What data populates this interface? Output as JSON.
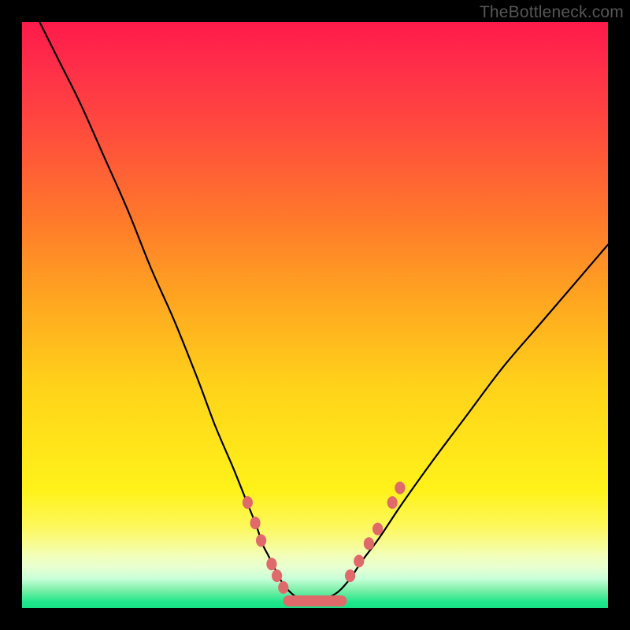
{
  "watermark": "TheBottleneck.com",
  "colors": {
    "marker": "#e06a6a",
    "curve": "#000000",
    "background_black": "#000000",
    "gradient_top": "#ff1a4a",
    "gradient_bottom": "#18e085"
  },
  "chart_data": {
    "type": "line",
    "title": "",
    "xlabel": "",
    "ylabel": "",
    "xlim": [
      0,
      100
    ],
    "ylim": [
      0,
      100
    ],
    "grid": false,
    "legend": false,
    "series": [
      {
        "name": "bottleneck-curve",
        "x": [
          3,
          6,
          10,
          14,
          18,
          22,
          26,
          30,
          33,
          36,
          38,
          40,
          41,
          42,
          43,
          44,
          45,
          46,
          47,
          48,
          49,
          50,
          51,
          52,
          54,
          56,
          58,
          61,
          65,
          70,
          76,
          82,
          88,
          94,
          100
        ],
        "y": [
          100,
          94,
          86,
          77,
          68,
          58,
          49,
          39,
          31,
          24,
          19,
          14,
          11,
          9,
          7,
          5,
          3.5,
          2.5,
          1.7,
          1.2,
          1,
          1,
          1.2,
          1.6,
          2.8,
          5,
          8,
          12,
          18,
          25,
          33,
          41,
          48,
          55,
          62
        ]
      }
    ],
    "markers": {
      "name": "highlight-points",
      "points": [
        {
          "x": 38.5,
          "y": 18
        },
        {
          "x": 39.8,
          "y": 14.5
        },
        {
          "x": 40.8,
          "y": 11.5
        },
        {
          "x": 42.6,
          "y": 7.5
        },
        {
          "x": 43.5,
          "y": 5.5
        },
        {
          "x": 44.6,
          "y": 3.5
        },
        {
          "x": 56.0,
          "y": 5.5
        },
        {
          "x": 57.5,
          "y": 8.0
        },
        {
          "x": 59.2,
          "y": 11.0
        },
        {
          "x": 60.7,
          "y": 13.5
        },
        {
          "x": 63.2,
          "y": 18.0
        },
        {
          "x": 64.5,
          "y": 20.5
        }
      ],
      "radius_px": 8
    },
    "trough_band": {
      "name": "optimal-range",
      "x_start": 45.5,
      "x_end": 54.5,
      "y": 1.2
    },
    "annotations": []
  }
}
